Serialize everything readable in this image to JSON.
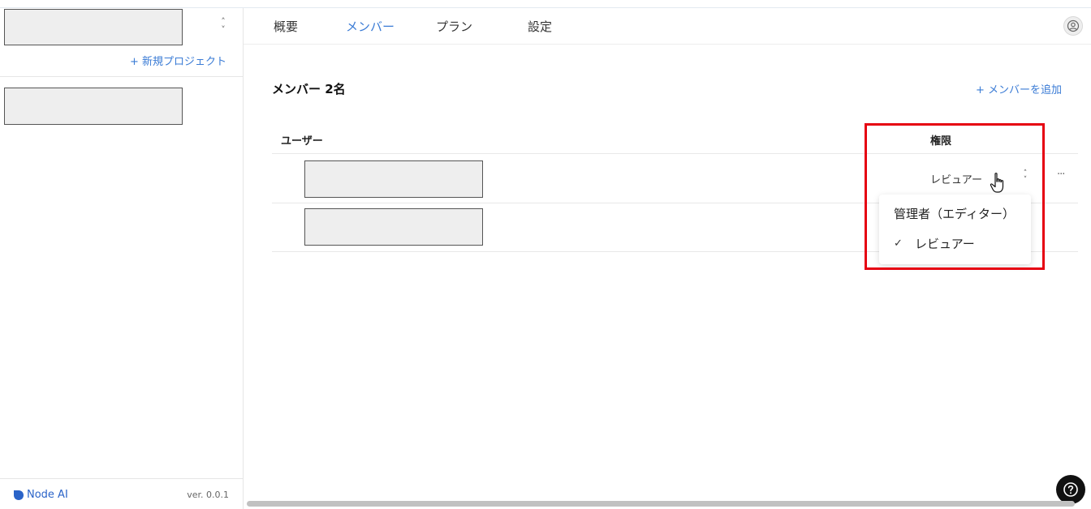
{
  "sidebar": {
    "new_project_label": "+ 新規プロジェクト",
    "brand_name": "Node AI",
    "version": "ver. 0.0.1",
    "brand_color": "#2a63c8"
  },
  "tabs": [
    {
      "label": "概要",
      "active": false
    },
    {
      "label": "メンバー",
      "active": true
    },
    {
      "label": "プラン",
      "active": false
    },
    {
      "label": "設定",
      "active": false
    }
  ],
  "main": {
    "member_count": "メンバー 2名",
    "add_member_label": "+ メンバーを追加",
    "columns": {
      "user": "ユーザー",
      "role": "権限"
    },
    "rows": [
      {
        "role": "レビュアー"
      }
    ]
  },
  "role_dropdown": {
    "options": [
      {
        "label": "管理者（エディター）",
        "selected": false
      },
      {
        "label": "レビュアー",
        "selected": true
      }
    ],
    "check_mark": "✓"
  },
  "colors": {
    "accent": "#3a7bd5",
    "highlight": "#e60012"
  },
  "icons": {
    "user": "user-circle-icon",
    "more": "ellipsis-icon",
    "help": "question-icon",
    "select": "chevron-up-down-icon"
  }
}
